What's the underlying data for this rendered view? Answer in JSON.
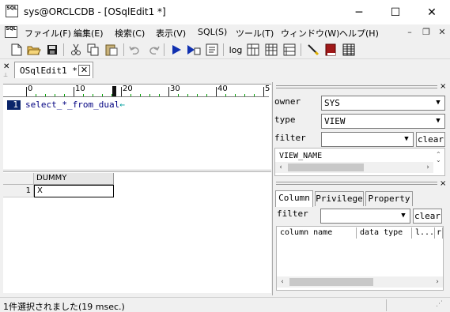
{
  "window": {
    "title": "sys@ORCLCDB - [OSqlEdit1 *]",
    "app_icon_text": "SQL",
    "minimize_glyph": "─",
    "maximize_glyph": "☐",
    "close_glyph": "✕"
  },
  "menu": {
    "icon_text": "SQL",
    "items": [
      {
        "label": "ファイル(F)"
      },
      {
        "label": "編集(E)"
      },
      {
        "label": "検索(C)"
      },
      {
        "label": "表示(V)"
      },
      {
        "label": "SQL(S)"
      },
      {
        "label": "ツール(T)"
      },
      {
        "label": "ウィンドウ(W)"
      },
      {
        "label": "ヘルプ(H)"
      }
    ],
    "mdi_min": "–",
    "mdi_restore": "❐",
    "mdi_close": "✕"
  },
  "toolbar": {
    "icons": [
      "new-file-icon",
      "open-folder-icon",
      "save-icon",
      "cut-icon",
      "copy-icon",
      "paste-icon",
      "undo-icon",
      "redo-icon",
      "execute-icon",
      "execute-step-icon",
      "explain-icon",
      "log-icon",
      "table-split-icon",
      "grid-icon",
      "grid2-icon",
      "pen-icon",
      "book-icon",
      "table-icon"
    ],
    "log_label": "log"
  },
  "tabs": [
    {
      "label": "OSqlEdit1 *",
      "close": "✕"
    }
  ],
  "tabstrip_close": "✕",
  "editor": {
    "ruler": [
      "0",
      "10",
      "20",
      "30",
      "40",
      "5"
    ],
    "line_number": "1",
    "sql": "select_*_from_dual",
    "eol_mark": "←"
  },
  "grid": {
    "columns": [
      "DUMMY"
    ],
    "rows": [
      {
        "num": "1",
        "values": [
          "X"
        ]
      }
    ]
  },
  "objects": {
    "owner_label": "owner",
    "owner_value": "SYS",
    "type_label": "type",
    "type_value": "VIEW",
    "filter_label": "filter",
    "filter_value": "",
    "clear_label": "clear",
    "list_header": "VIEW_NAME"
  },
  "columns_panel": {
    "tabs": [
      "Column",
      "Privilege",
      "Property"
    ],
    "active_tab": "Column",
    "filter_label": "filter",
    "filter_value": "",
    "clear_label": "clear",
    "headers": [
      "column name",
      "data type",
      "l...",
      "r"
    ]
  },
  "status": {
    "text": "1件選択されました(19 msec.)"
  }
}
